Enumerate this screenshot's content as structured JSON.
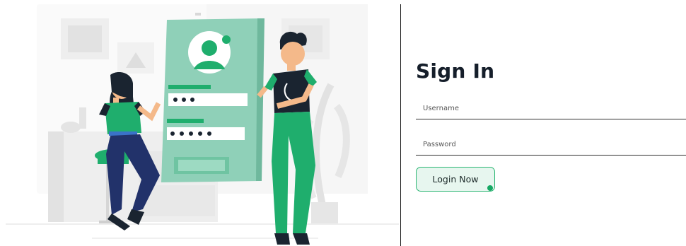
{
  "signin": {
    "title": "Sign In",
    "username_placeholder": "Username",
    "password_placeholder": "Password",
    "login_label": "Login Now"
  },
  "colors": {
    "accent": "#2bb673",
    "button_bg": "#e7f6ef",
    "phone_green": "#8fd0b8",
    "figure_green": "#1eac6a"
  },
  "illustration": {
    "icon": "login-illustration-icon"
  }
}
